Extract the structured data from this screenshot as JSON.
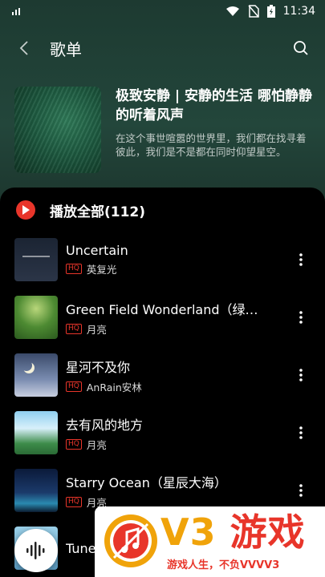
{
  "status_bar": {
    "time": "11:34"
  },
  "header": {
    "title": "歌单"
  },
  "playlist": {
    "title": "极致安静 | 安静的生活 哪怕静静的听着风声",
    "description": "在这个事世喧嚣的世界里，我们都在找寻着彼此，我们是不是都在同时仰望星空。"
  },
  "play_all": {
    "label": "播放全部(112)"
  },
  "songs": [
    {
      "title": "Uncertain",
      "badge": "HQ",
      "artist": "英复光"
    },
    {
      "title": "Green Field Wonderland（绿…",
      "badge": "HQ",
      "artist": "月亮"
    },
    {
      "title": "星河不及你",
      "badge": "HQ",
      "artist": "AnRain安林"
    },
    {
      "title": "去有风的地方",
      "badge": "HQ",
      "artist": "月亮"
    },
    {
      "title": "Starry Ocean（星辰大海）",
      "badge": "HQ",
      "artist": "月亮"
    },
    {
      "title": "Tune",
      "badge": "",
      "artist": ""
    }
  ],
  "watermark": {
    "logo_text": "V3",
    "cn_text": "游戏",
    "slogan": "游戏人生，不负VVVV3"
  },
  "colors": {
    "accent": "#e8352a",
    "header_bg": "#1f3a32",
    "list_bg": "#000000"
  }
}
